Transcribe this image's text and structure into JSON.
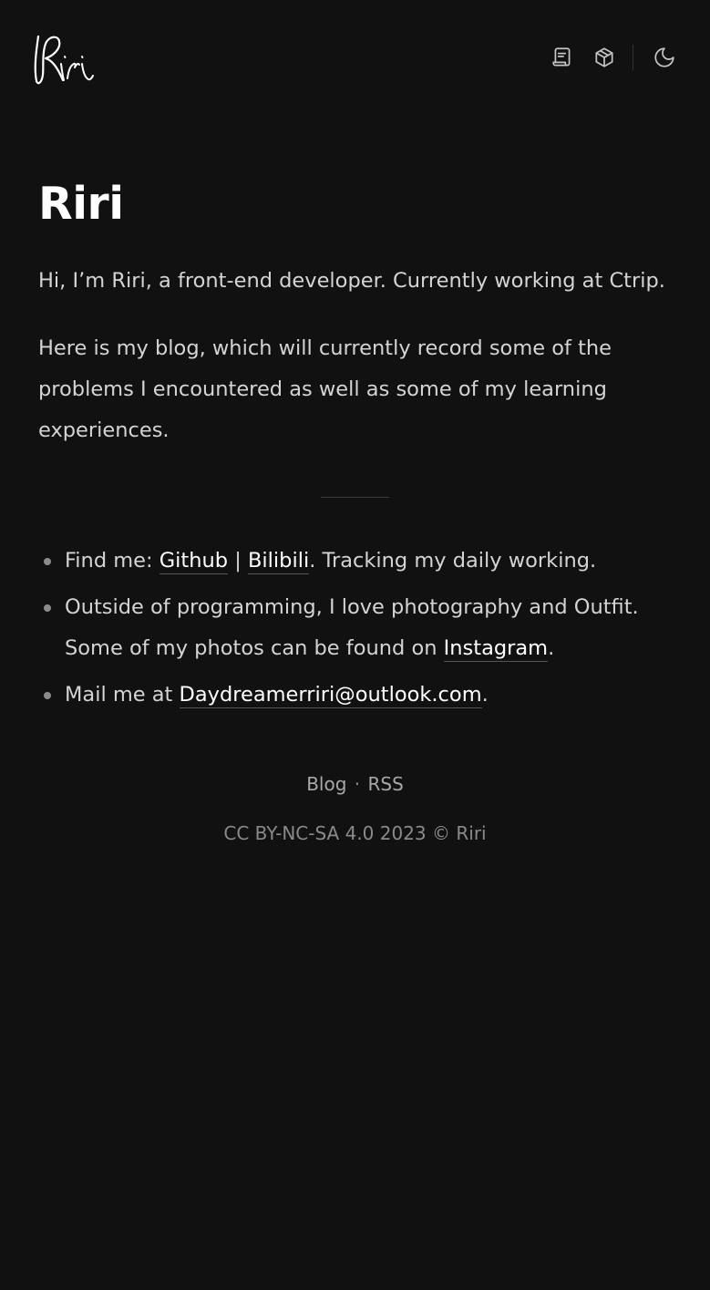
{
  "header": {
    "logo_text": "Riri",
    "nav": [
      {
        "icon": "blog-icon",
        "label": "Blog"
      },
      {
        "icon": "projects-icon",
        "label": "Projects"
      },
      {
        "icon": "moon-icon",
        "label": "Toggle theme"
      }
    ]
  },
  "main": {
    "title": "Riri",
    "paragraphs": [
      "Hi, I’m Riri, a front-end developer. Currently working at Ctrip.",
      "Here is my blog, which will currently record some of the problems I encountered as well as some of my learning experiences."
    ],
    "facts": {
      "find_prefix": "Find me: ",
      "github": "Github",
      "pipe": "|",
      "bilibili": "Bilibili",
      "find_suffix": ". Tracking my daily working.",
      "photo_prefix": "Outside of programming, I love photography and Outfit. Some of my photos can be found on ",
      "instagram": "Instagram",
      "photo_suffix": ".",
      "mail_prefix": "Mail me at ",
      "email": "Daydreamerriri@outlook.com",
      "mail_suffix": "."
    }
  },
  "footer": {
    "blog": "Blog",
    "dot": "·",
    "rss": "RSS",
    "copyright": "CC BY-NC-SA 4.0 2023 © Riri"
  },
  "colors": {
    "background": "#111111",
    "text": "#d4d4d4",
    "heading": "#ffffff",
    "muted": "#8a8a8a"
  }
}
